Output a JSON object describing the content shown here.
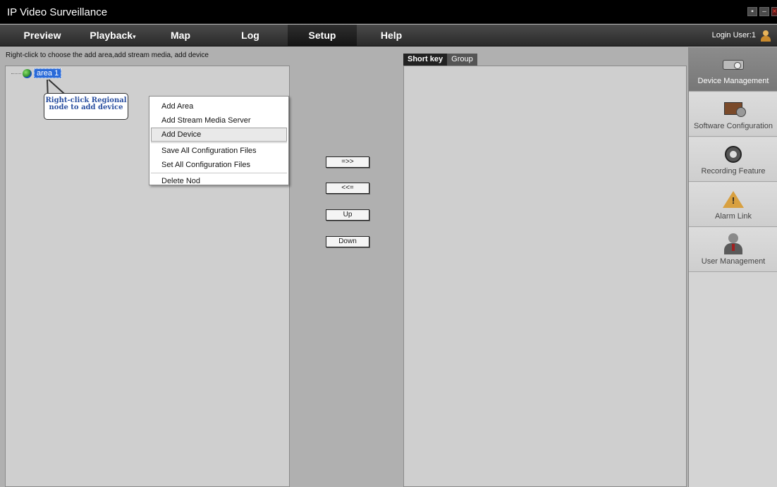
{
  "window": {
    "title": "IP Video Surveillance"
  },
  "menu": {
    "items": [
      {
        "label": "Preview"
      },
      {
        "label": "Playback"
      },
      {
        "label": "Map"
      },
      {
        "label": "Log"
      },
      {
        "label": "Setup"
      },
      {
        "label": "Help"
      }
    ],
    "login_user": "Login User:1"
  },
  "hint": "Right-click to choose the add area,add stream media, add device",
  "tree": {
    "node_label": "area 1"
  },
  "callout": {
    "line1": "Right-click Regional",
    "line2": "node to add device"
  },
  "context_menu": {
    "items": [
      "Add Area",
      "Add Stream Media Server",
      "Add Device",
      "Save All Configuration Files",
      "Set All Configuration Files",
      "Delete Nod"
    ],
    "highlighted": "Add Device"
  },
  "middle_buttons": {
    "add": "=>>",
    "remove": "<<=",
    "up": "Up",
    "down": "Down"
  },
  "right_tabs": {
    "short_key": "Short key",
    "group": "Group"
  },
  "sidebar": {
    "items": [
      {
        "label": "Device Management",
        "icon": "projector-icon"
      },
      {
        "label": "Software Configuration",
        "icon": "software-config-icon"
      },
      {
        "label": "Recording Feature",
        "icon": "film-reel-icon"
      },
      {
        "label": "Alarm Link",
        "icon": "warning-icon"
      },
      {
        "label": "User Management",
        "icon": "person-icon"
      }
    ]
  }
}
